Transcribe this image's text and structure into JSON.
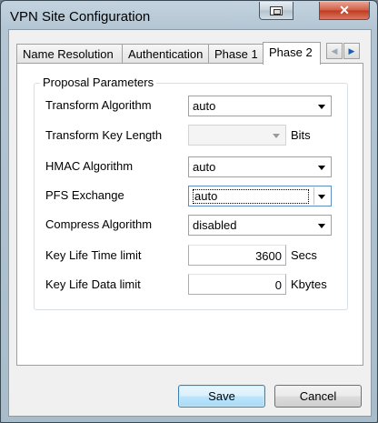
{
  "window": {
    "title": "VPN Site Configuration",
    "close_glyph": "✕"
  },
  "tabs": [
    {
      "label": "Name Resolution"
    },
    {
      "label": "Authentication"
    },
    {
      "label": "Phase 1"
    },
    {
      "label": "Phase 2",
      "selected": true
    }
  ],
  "tab_scroll": {
    "left": "◀",
    "right": "▶"
  },
  "group": {
    "legend": "Proposal Parameters"
  },
  "fields": {
    "transform_algorithm": {
      "label": "Transform Algorithm",
      "value": "auto"
    },
    "transform_key_length": {
      "label": "Transform Key Length",
      "value": "",
      "unit": "Bits"
    },
    "hmac_algorithm": {
      "label": "HMAC Algorithm",
      "value": "auto"
    },
    "pfs_exchange": {
      "label": "PFS Exchange",
      "value": "auto"
    },
    "compress_algorithm": {
      "label": "Compress Algorithm",
      "value": "disabled"
    },
    "key_life_time": {
      "label": "Key Life Time limit",
      "value": "3600",
      "unit": "Secs"
    },
    "key_life_data": {
      "label": "Key Life Data limit",
      "value": "0",
      "unit": "Kbytes"
    }
  },
  "buttons": {
    "save": "Save",
    "cancel": "Cancel"
  }
}
